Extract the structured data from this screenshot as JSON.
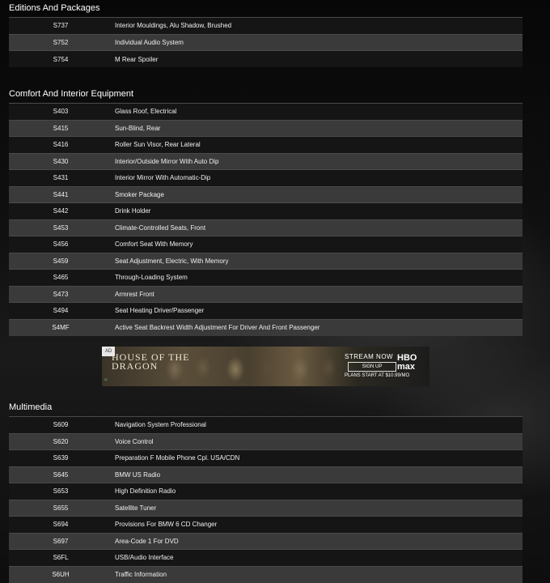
{
  "sections": [
    {
      "title": "Editions And Packages",
      "rows": [
        {
          "code": "S737",
          "desc": "Interior Mouldings, Alu Shadow, Brushed"
        },
        {
          "code": "S752",
          "desc": "Individual Audio System"
        },
        {
          "code": "S754",
          "desc": "M Rear Spoiler"
        }
      ]
    },
    {
      "title": "Comfort And Interior Equipment",
      "rows": [
        {
          "code": "S403",
          "desc": "Glass Roof, Electrical"
        },
        {
          "code": "S415",
          "desc": "Sun-Blind, Rear"
        },
        {
          "code": "S416",
          "desc": "Roller Sun Visor, Rear Lateral"
        },
        {
          "code": "S430",
          "desc": "Interior/Outside Mirror With Auto Dip"
        },
        {
          "code": "S431",
          "desc": "Interior Mirror With Automatic-Dip"
        },
        {
          "code": "S441",
          "desc": "Smoker Package"
        },
        {
          "code": "S442",
          "desc": "Drink Holder"
        },
        {
          "code": "S453",
          "desc": "Climate-Controlled Seats, Front"
        },
        {
          "code": "S456",
          "desc": "Comfort Seat With Memory"
        },
        {
          "code": "S459",
          "desc": "Seat Adjustment, Electric, With Memory"
        },
        {
          "code": "S465",
          "desc": "Through-Loading System"
        },
        {
          "code": "S473",
          "desc": "Armrest Front"
        },
        {
          "code": "S494",
          "desc": "Seat Heating Driver/Passenger"
        },
        {
          "code": "S4MF",
          "desc": "Active Seat Backrest Width Adjustment For Driver And Front Passenger"
        }
      ]
    },
    {
      "title": "Multimedia",
      "rows": [
        {
          "code": "S609",
          "desc": "Navigation System Professional"
        },
        {
          "code": "S620",
          "desc": "Voice Control"
        },
        {
          "code": "S639",
          "desc": "Preparation F Mobile Phone Cpl. USA/CDN"
        },
        {
          "code": "S645",
          "desc": "BMW US Radio"
        },
        {
          "code": "S653",
          "desc": "High Definition Radio"
        },
        {
          "code": "S655",
          "desc": "Satellite Tuner"
        },
        {
          "code": "S694",
          "desc": "Provisions For BMW 6 CD Changer"
        },
        {
          "code": "S697",
          "desc": "Area-Code 1 For DVD"
        },
        {
          "code": "S6FL",
          "desc": "USB/Audio Interface"
        },
        {
          "code": "S6UH",
          "desc": "Traffic Information"
        }
      ]
    }
  ],
  "ad": {
    "tag": "AD",
    "logo_line1": "HOUSE OF THE",
    "logo_line2": "DRAGON",
    "stream": "STREAM NOW",
    "brand": "HBO max",
    "signup": "SIGN UP",
    "plans": "PLANS START AT $10.99/MO",
    "feedback_icon": "signal-icon"
  }
}
